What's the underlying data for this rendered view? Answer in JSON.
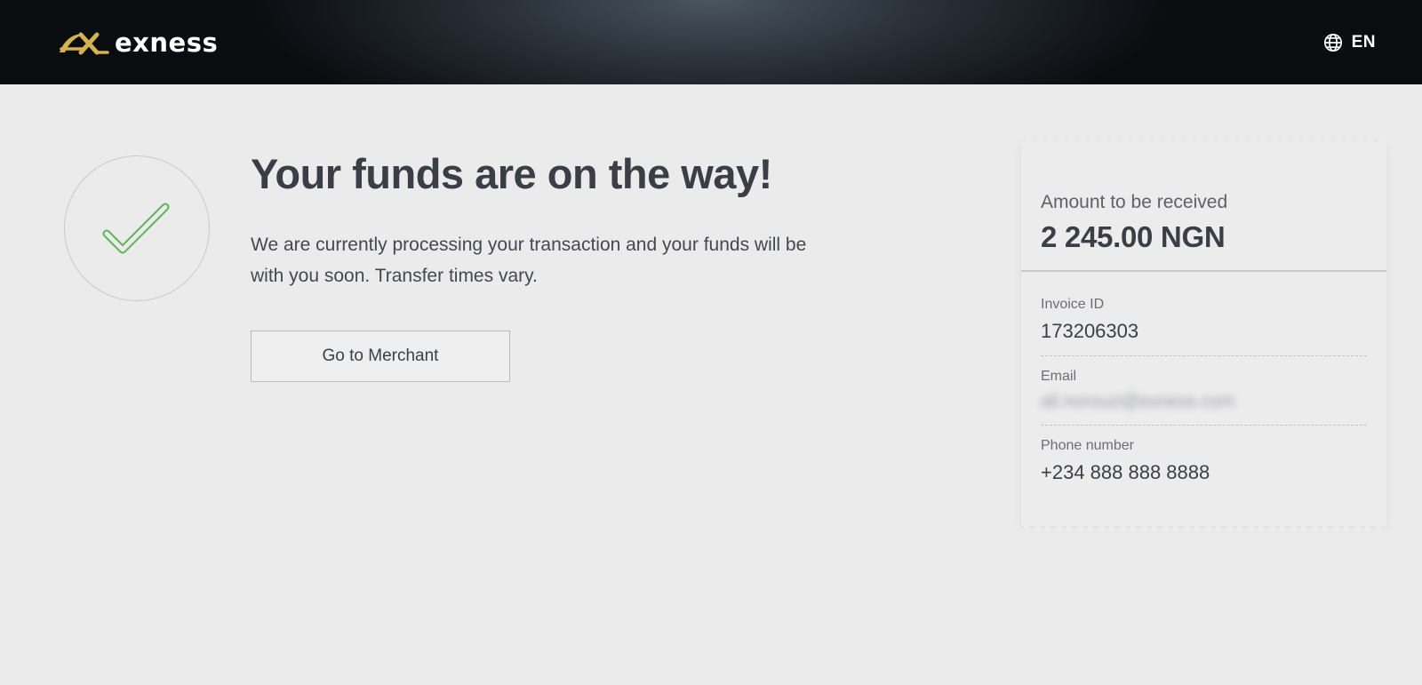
{
  "header": {
    "brand": "exness",
    "logo_icon": "exness-logo-mark",
    "language_icon": "globe-icon",
    "language": "EN"
  },
  "status": {
    "icon": "check-icon",
    "title": "Your funds are on the way!",
    "description": "We are currently processing your transaction and your funds will be with you soon. Transfer times vary.",
    "merchant_button": "Go to Merchant"
  },
  "receipt": {
    "amount_label": "Amount to be received",
    "amount_value": "2 245.00 NGN",
    "fields": [
      {
        "label": "Invoice ID",
        "value": "173206303"
      },
      {
        "label": "Email",
        "value": "ali.norouzi@exness.com"
      },
      {
        "label": "Phone number",
        "value": "+234 888 888 8888"
      }
    ]
  },
  "colors": {
    "logo_gold": "#d4b24c",
    "check_green": "#5ab553",
    "page_bg": "#ebebeb"
  }
}
